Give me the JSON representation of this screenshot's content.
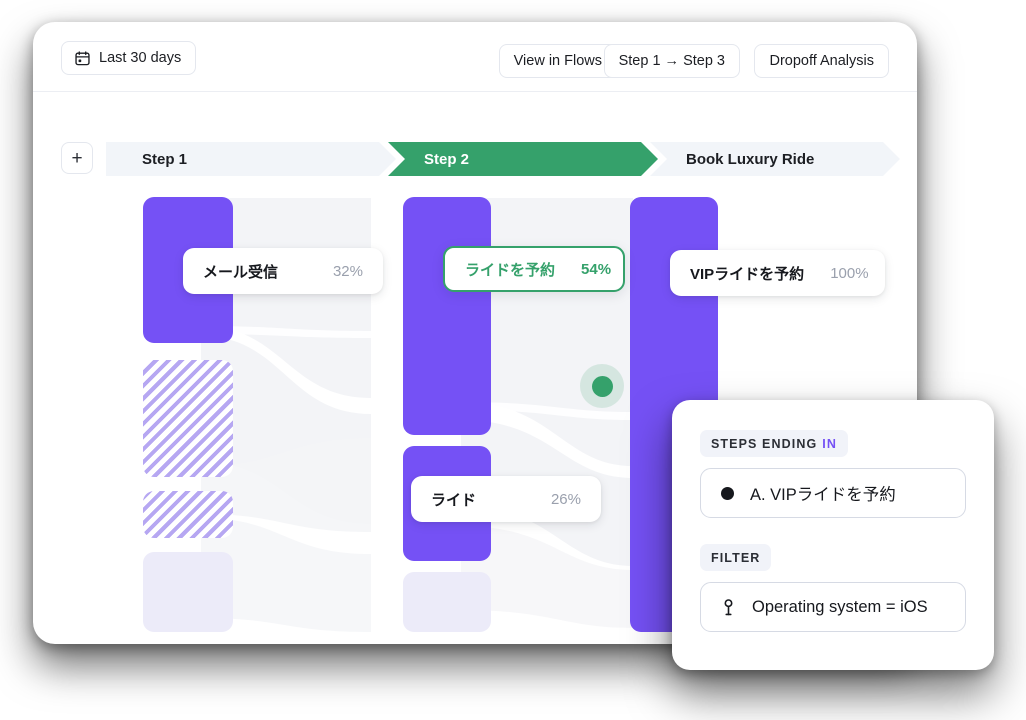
{
  "toolbar": {
    "date_range": "Last 30 days",
    "view_in_flows": "View in Flows",
    "step_range": "Step 1 → Step 3",
    "dropoff_analysis": "Dropoff Analysis"
  },
  "steps": {
    "add_label": "+",
    "items": [
      {
        "label": "Step 1",
        "active": false
      },
      {
        "label": "Step 2",
        "active": true
      },
      {
        "label": "Book Luxury Ride",
        "active": false
      }
    ]
  },
  "funnel": {
    "nodes": [
      {
        "name": "メール受信",
        "percent": "32%",
        "highlighted": false
      },
      {
        "name": "ライドを予約",
        "percent": "54%",
        "highlighted": true
      },
      {
        "name": "VIPライドを予約",
        "percent": "100%",
        "highlighted": false
      },
      {
        "name": "ライド",
        "percent": "26%",
        "highlighted": false
      }
    ]
  },
  "panel": {
    "steps_ending_label": "STEPS ENDING",
    "steps_ending_accent": "IN",
    "selected_step": "A. VIPライドを予約",
    "filter_label": "FILTER",
    "filter_value": "Operating system = iOS"
  },
  "colors": {
    "purple": "#7551f5",
    "green": "#35a16b",
    "faint_purple": "#ecebf9",
    "hatch_purple": "#b6a7f2",
    "chevron_bg": "#f2f5f9",
    "ribbon": "#f3f4f7"
  },
  "chart_data": {
    "type": "bar",
    "title": "",
    "categories": [
      "Step 1",
      "Step 2",
      "Book Luxury Ride"
    ],
    "series": [
      {
        "name": "メール受信",
        "step": "Step 1",
        "value": 32,
        "label": "32%"
      },
      {
        "name": "ライドを予約",
        "step": "Step 2",
        "value": 54,
        "label": "54%"
      },
      {
        "name": "ライド",
        "step": "Step 2",
        "value": 26,
        "label": "26%"
      },
      {
        "name": "VIPライドを予約",
        "step": "Book Luxury Ride",
        "value": 100,
        "label": "100%"
      }
    ],
    "ylabel": "",
    "xlabel": "",
    "grid": false,
    "legend": "none"
  }
}
